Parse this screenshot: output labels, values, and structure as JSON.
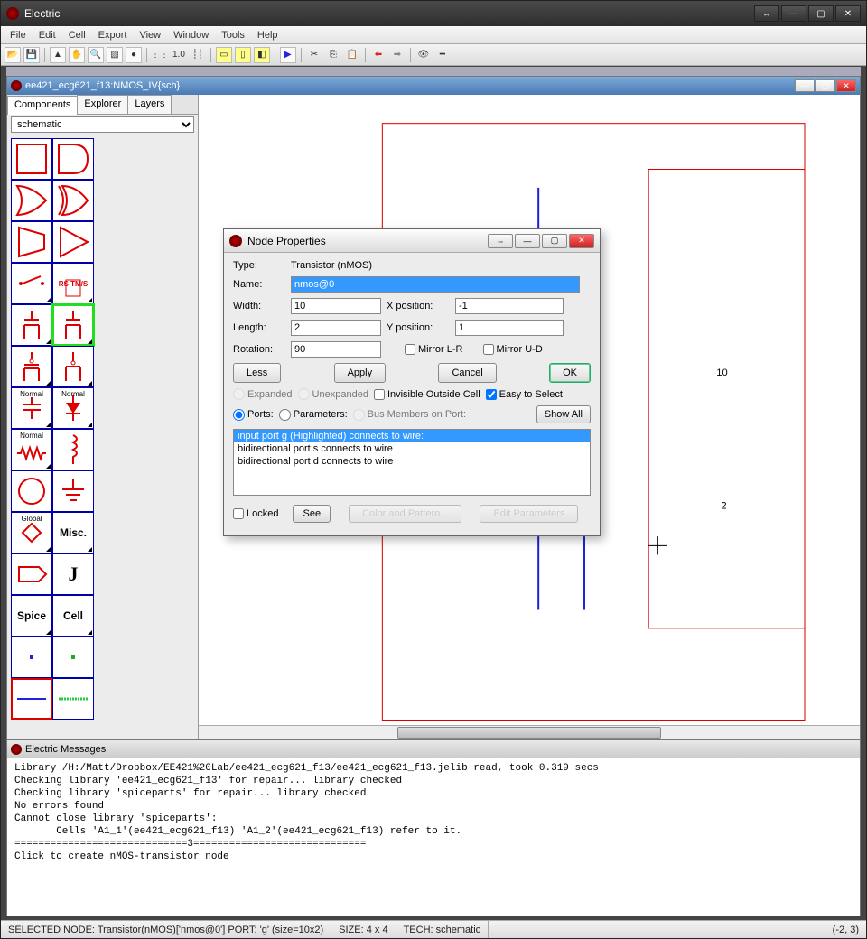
{
  "app": {
    "title": "Electric"
  },
  "menu": [
    "File",
    "Edit",
    "Cell",
    "Export",
    "View",
    "Window",
    "Tools",
    "Help"
  ],
  "toolbar": {
    "zoom_label": "1.0"
  },
  "child": {
    "title": "ee421_ecg621_f13:NMOS_IV{sch}",
    "tabs": [
      "Components",
      "Explorer",
      "Layers"
    ],
    "tech_select": "schematic"
  },
  "palette_text": {
    "rstms": "RS TM/S",
    "normal": "Normal",
    "global": "Global",
    "misc": "Misc.",
    "j": "J",
    "spice": "Spice",
    "cell": "Cell"
  },
  "schematic": {
    "width_label": "10",
    "length_label": "2"
  },
  "dialog": {
    "title": "Node Properties",
    "type_label": "Type:",
    "type_value": "Transistor (nMOS)",
    "name_label": "Name:",
    "name_value": "nmos@0",
    "width_label": "Width:",
    "width_value": "10",
    "xpos_label": "X position:",
    "xpos_value": "-1",
    "length_label": "Length:",
    "length_value": "2",
    "ypos_label": "Y position:",
    "ypos_value": "1",
    "rotation_label": "Rotation:",
    "rotation_value": "90",
    "mirror_lr": "Mirror L-R",
    "mirror_ud": "Mirror U-D",
    "less": "Less",
    "apply": "Apply",
    "cancel": "Cancel",
    "ok": "OK",
    "expanded": "Expanded",
    "unexpanded": "Unexpanded",
    "invisible": "Invisible Outside Cell",
    "easy": "Easy to Select",
    "ports": "Ports:",
    "parameters": "Parameters:",
    "busmembers": "Bus Members on Port:",
    "showall": "Show All",
    "list": [
      "input port g (Highlighted) connects to wire:",
      "bidirectional port s connects to wire",
      "bidirectional port d connects to wire"
    ],
    "locked": "Locked",
    "see": "See",
    "colorpattern": "Color and Pattern...",
    "editparams": "Edit Parameters"
  },
  "messages": {
    "title": "Electric Messages",
    "lines": [
      "Library /H:/Matt/Dropbox/EE421%20Lab/ee421_ecg621_f13/ee421_ecg621_f13.jelib read, took 0.319 secs",
      "Checking library 'ee421_ecg621_f13' for repair... library checked",
      "Checking library 'spiceparts' for repair... library checked",
      "No errors found",
      "Cannot close library 'spiceparts':",
      "       Cells 'A1_1'(ee421_ecg621_f13) 'A1_2'(ee421_ecg621_f13) refer to it.",
      "=============================3=============================",
      "Click to create nMOS-transistor node"
    ]
  },
  "status": {
    "selected": "SELECTED NODE: Transistor(nMOS)['nmos@0'] PORT: 'g' (size=10x2)",
    "size": "SIZE: 4 x 4",
    "tech": "TECH: schematic",
    "coords": "(-2, 3)"
  }
}
